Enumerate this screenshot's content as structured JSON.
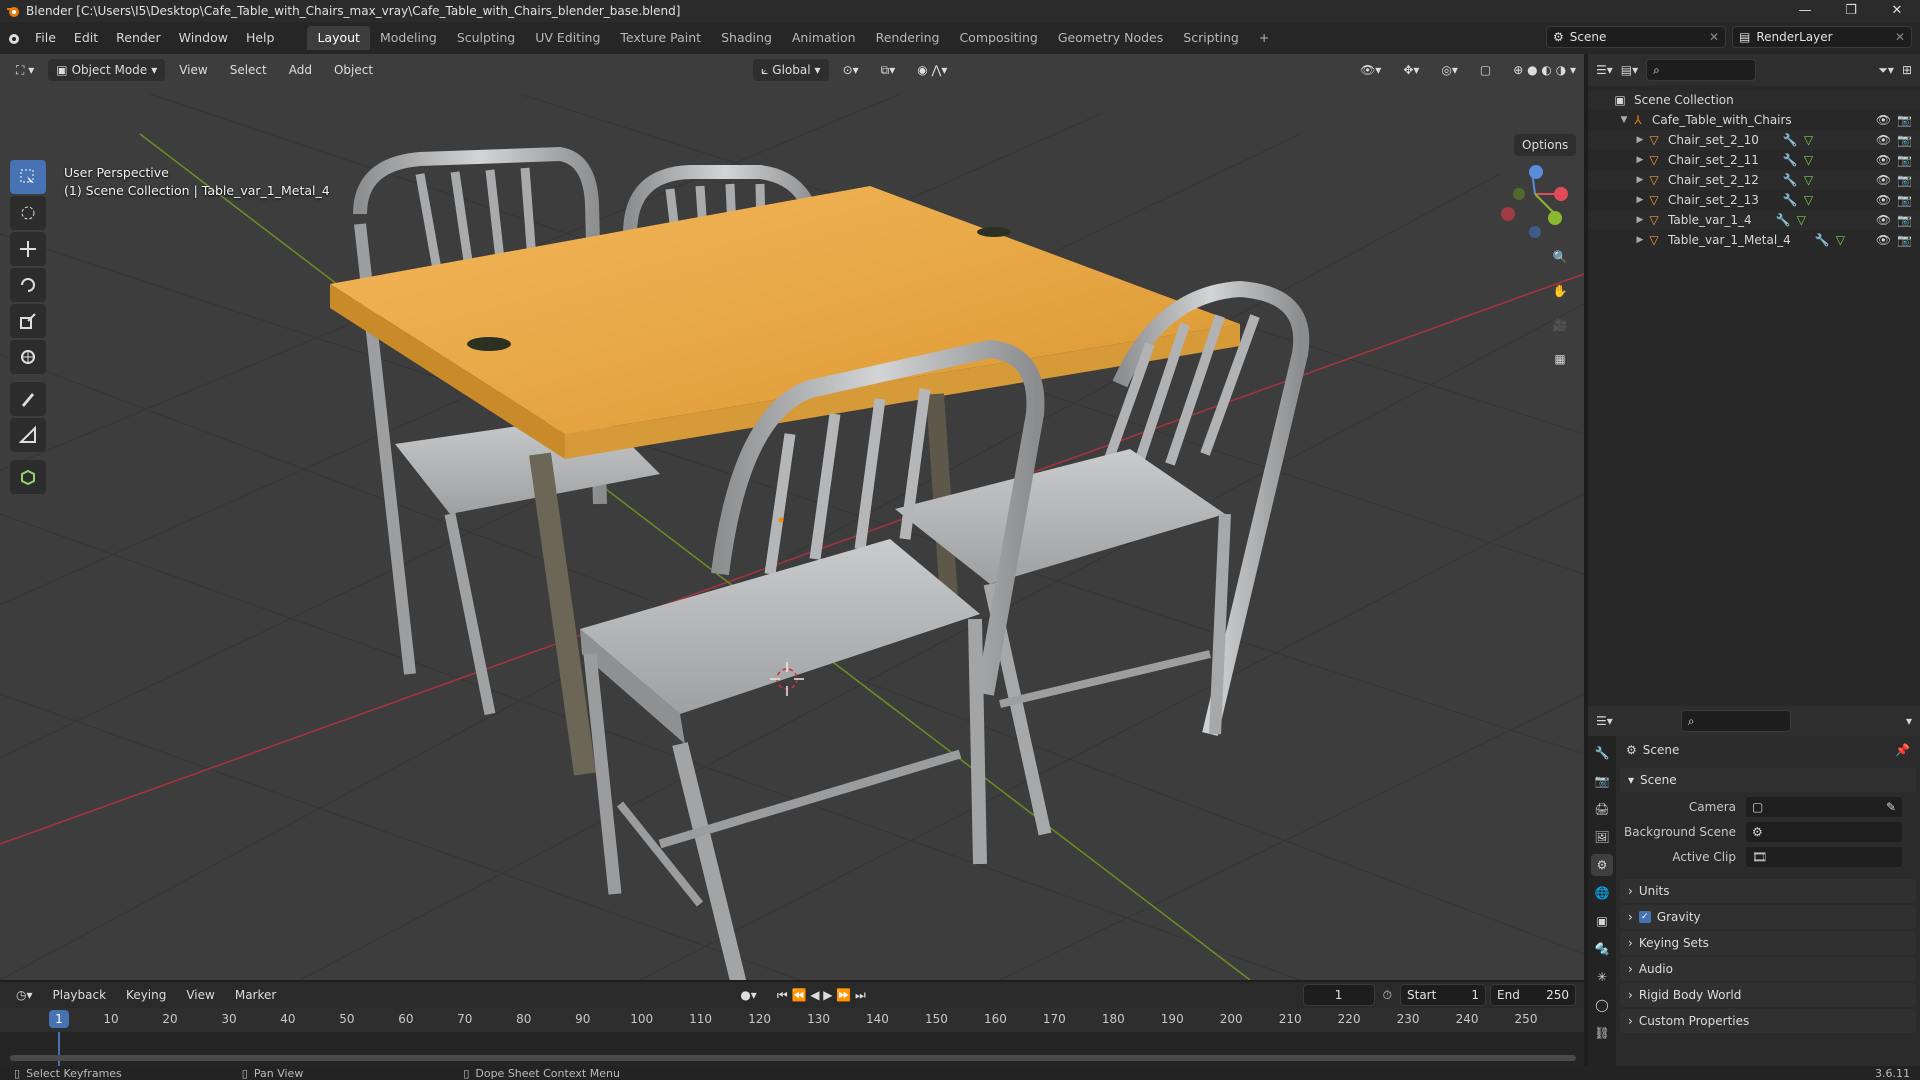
{
  "window": {
    "title": "Blender [C:\\Users\\I5\\Desktop\\Cafe_Table_with_Chairs_max_vray\\Cafe_Table_with_Chairs_blender_base.blend]",
    "controls": [
      "—",
      "❐",
      "✕"
    ]
  },
  "menu": [
    "File",
    "Edit",
    "Render",
    "Window",
    "Help"
  ],
  "workspaces": [
    "Layout",
    "Modeling",
    "Sculpting",
    "UV Editing",
    "Texture Paint",
    "Shading",
    "Animation",
    "Rendering",
    "Compositing",
    "Geometry Nodes",
    "Scripting",
    "+"
  ],
  "active_workspace": "Layout",
  "scene_field": "Scene",
  "renderlayer_field": "RenderLayer",
  "viewport": {
    "mode": "Object Mode",
    "menus": [
      "View",
      "Select",
      "Add",
      "Object"
    ],
    "orientation": "Global",
    "options": "Options",
    "info_line1": "User Perspective",
    "info_line2": "(1) Scene Collection | Table_var_1_Metal_4",
    "gizmo": {
      "x": "X",
      "y": "Y",
      "z": "Z"
    }
  },
  "outliner": {
    "root": "Scene Collection",
    "collection": "Cafe_Table_with_Chairs",
    "items": [
      "Chair_set_2_10",
      "Chair_set_2_11",
      "Chair_set_2_12",
      "Chair_set_2_13",
      "Table_var_1_4",
      "Table_var_1_Metal_4"
    ]
  },
  "properties": {
    "context": "Scene",
    "panel": "Scene",
    "camera_label": "Camera",
    "background_label": "Background Scene",
    "clip_label": "Active Clip",
    "sections": [
      "Units",
      "Gravity",
      "Keying Sets",
      "Audio",
      "Rigid Body World",
      "Custom Properties"
    ]
  },
  "timeline": {
    "menus": [
      "Playback",
      "Keying",
      "View",
      "Marker"
    ],
    "current_frame": "1",
    "start_label": "Start",
    "start": "1",
    "end_label": "End",
    "end": "250",
    "ticks": [
      "10",
      "20",
      "30",
      "40",
      "50",
      "60",
      "70",
      "80",
      "90",
      "100",
      "110",
      "120",
      "130",
      "140",
      "150",
      "160",
      "170",
      "180",
      "190",
      "200",
      "210",
      "220",
      "230",
      "240",
      "250"
    ],
    "cursor_label": "1"
  },
  "status": {
    "left": "Select Keyframes",
    "middle": "Pan View",
    "right": "Dope Sheet Context Menu",
    "version": "3.6.11"
  },
  "colors": {
    "accent": "#4772b3",
    "grid": "#3d3d3d",
    "table_top": "#e8a846",
    "chair": "#b4b6b8",
    "x_axis": "#a8333f",
    "y_axis": "#6b8f22"
  }
}
